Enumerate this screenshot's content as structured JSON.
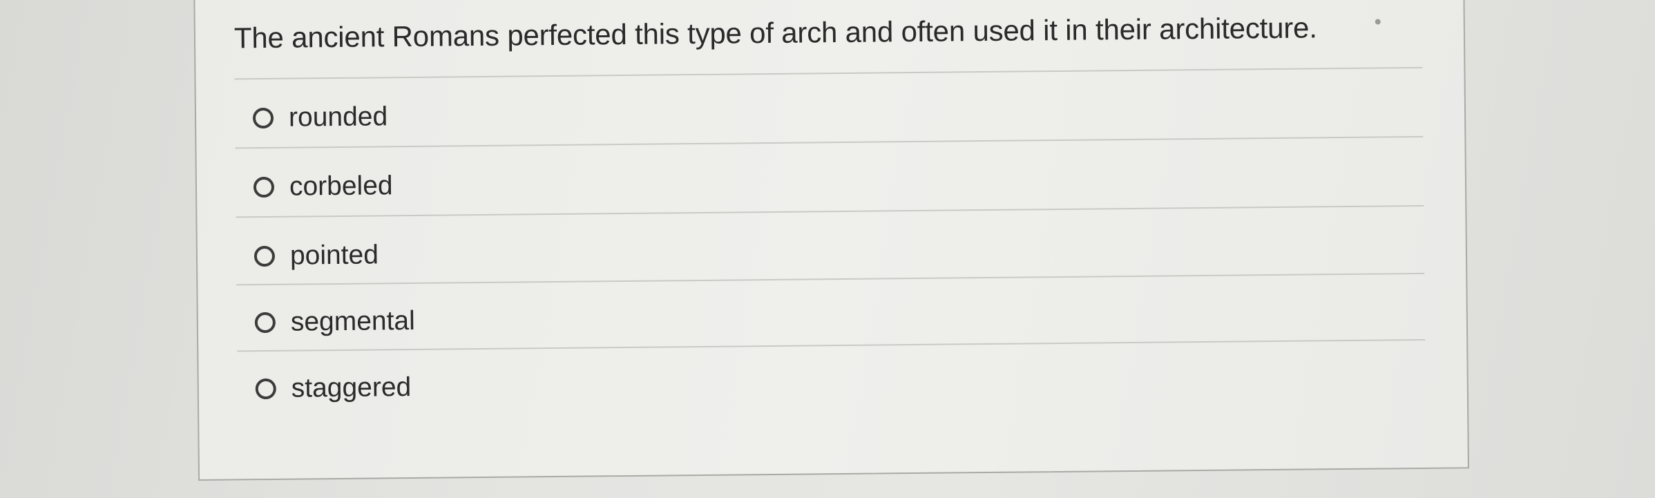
{
  "question": {
    "text": "The ancient Romans perfected this type of arch and often used it in their architecture."
  },
  "options": [
    {
      "label": "rounded",
      "selected": false
    },
    {
      "label": "corbeled",
      "selected": false
    },
    {
      "label": "pointed",
      "selected": false
    },
    {
      "label": "segmental",
      "selected": false
    },
    {
      "label": "staggered",
      "selected": false
    }
  ]
}
